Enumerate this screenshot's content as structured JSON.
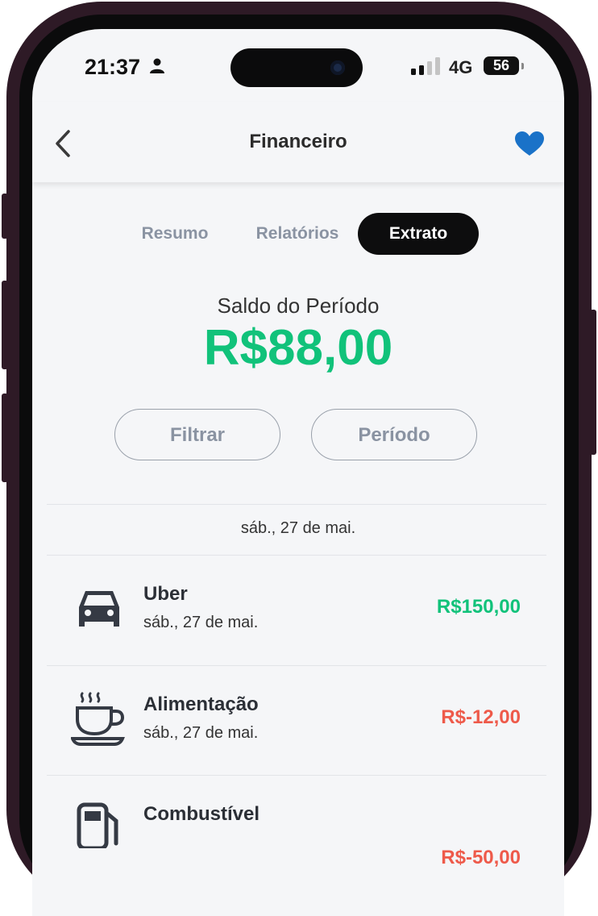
{
  "status_bar": {
    "time": "21:37",
    "network": "4G",
    "battery": "56"
  },
  "nav": {
    "title": "Financeiro"
  },
  "tabs": [
    {
      "label": "Resumo",
      "active": false
    },
    {
      "label": "Relatórios",
      "active": false
    },
    {
      "label": "Extrato",
      "active": true
    }
  ],
  "balance": {
    "label": "Saldo do Período",
    "value": "R$88,00"
  },
  "filters": {
    "filter_label": "Filtrar",
    "period_label": "Período"
  },
  "date_group": "sáb., 27 de mai.",
  "transactions": [
    {
      "title": "Uber",
      "date": "sáb., 27 de mai.",
      "amount": "R$150,00",
      "icon": "car-icon"
    },
    {
      "title": "Alimentação",
      "date": "sáb., 27 de mai.",
      "amount": "R$-12,00",
      "icon": "coffee-cup-icon"
    },
    {
      "title": "Combustível",
      "date": "",
      "amount": "R$-50,00",
      "icon": "fuel-pump-icon"
    }
  ],
  "colors": {
    "positive": "#11c27a",
    "negative": "#ee5a4a",
    "heart": "#1a72c8",
    "active_tab_bg": "#0d0d0e",
    "frame": "#2e1a26"
  }
}
